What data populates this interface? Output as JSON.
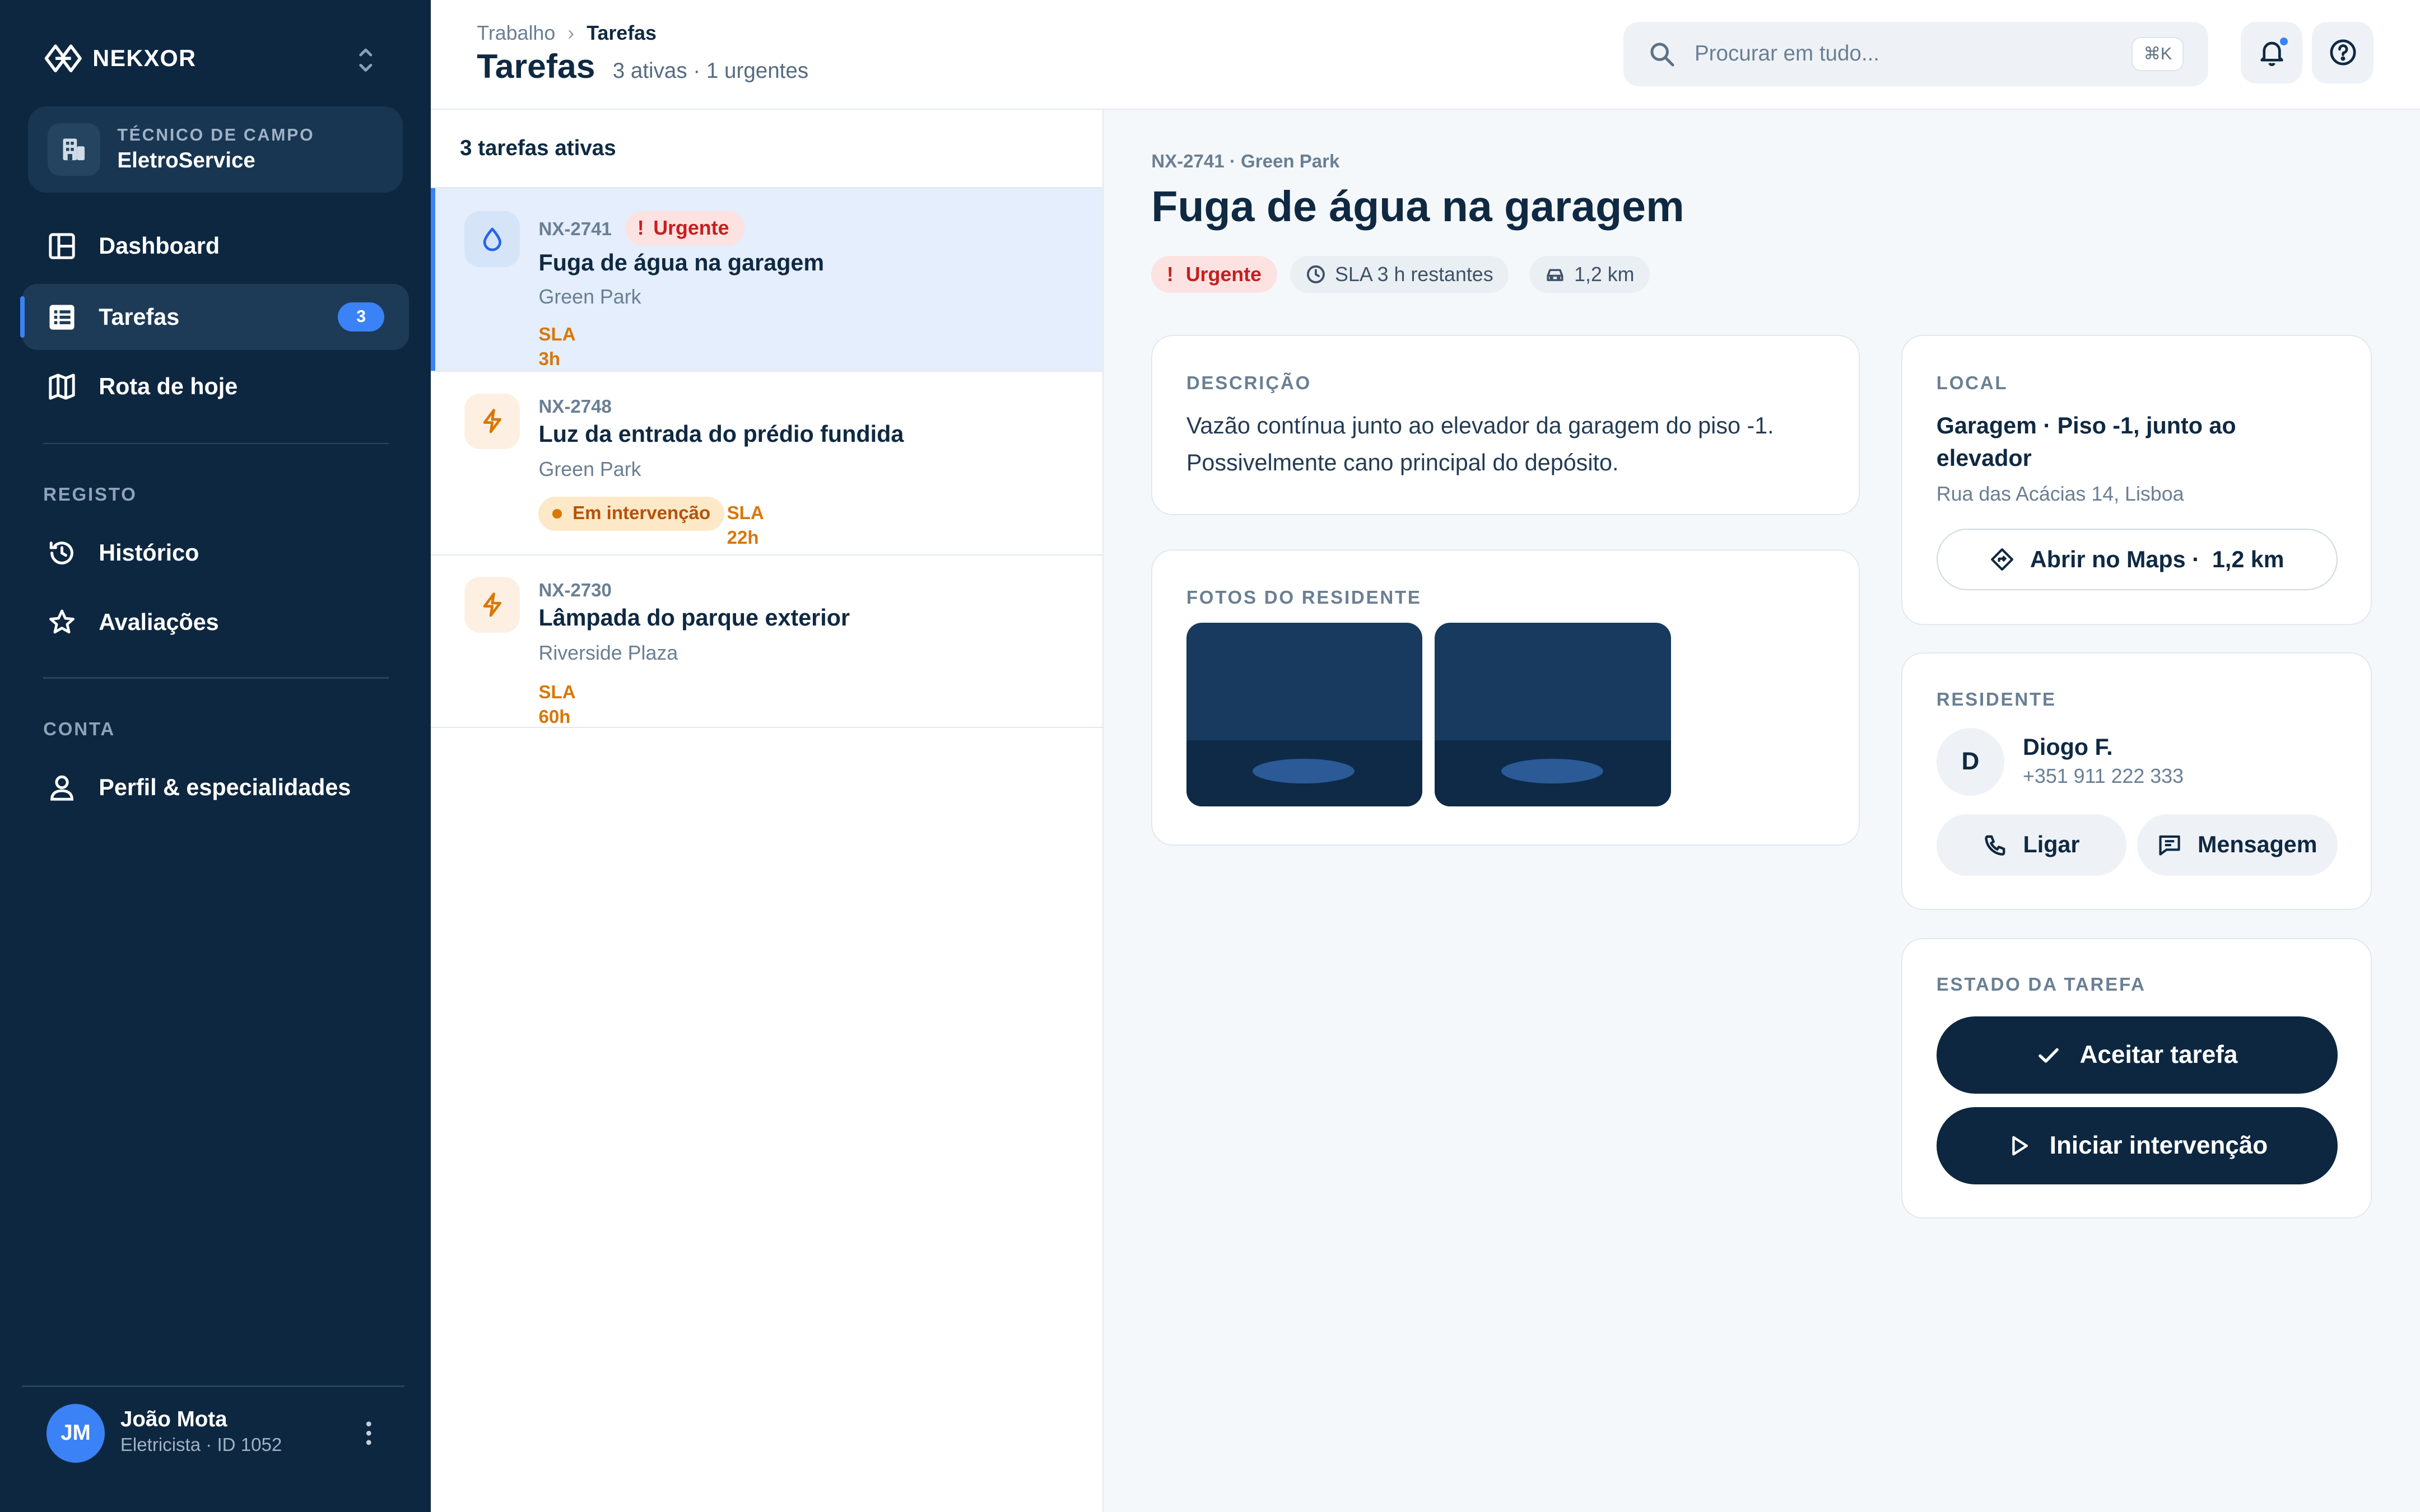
{
  "brand": {
    "name": "NEKXOR"
  },
  "org": {
    "role": "TÉCNICO DE CAMPO",
    "name": "EletroService"
  },
  "nav": {
    "items": [
      {
        "label": "Dashboard"
      },
      {
        "label": "Tarefas",
        "badge": "3"
      },
      {
        "label": "Rota de hoje"
      }
    ],
    "registo_label": "REGISTO",
    "registo_items": [
      {
        "label": "Histórico"
      },
      {
        "label": "Avaliações"
      }
    ],
    "conta_label": "CONTA",
    "conta_items": [
      {
        "label": "Perfil & especialidades"
      }
    ]
  },
  "user": {
    "initials": "JM",
    "name": "João Mota",
    "subtitle": "Eletricista · ID 1052"
  },
  "header": {
    "breadcrumb": [
      "Trabalho",
      "Tarefas"
    ],
    "title": "Tarefas",
    "subtitle": "3 ativas · 1 urgentes",
    "search_placeholder": "Procurar em tudo...",
    "search_shortcut": "⌘K"
  },
  "list": {
    "heading": "3 tarefas ativas",
    "tasks": [
      {
        "id": "NX-2741",
        "urgent_label": "Urgente",
        "title": "Fuga de água na garagem",
        "location": "Green Park",
        "sla_label": "SLA",
        "sla_value": "3h",
        "icon": "droplet-icon"
      },
      {
        "id": "NX-2748",
        "title": "Luz da entrada do prédio fundida",
        "location": "Green Park",
        "status": "Em intervenção",
        "sla_label": "SLA",
        "sla_value": "22h",
        "icon": "bolt-icon"
      },
      {
        "id": "NX-2730",
        "title": "Lâmpada do parque exterior",
        "location": "Riverside Plaza",
        "sla_label": "SLA",
        "sla_value": "60h",
        "icon": "bolt-icon"
      }
    ]
  },
  "detail": {
    "meta": "NX-2741 · Green Park",
    "title": "Fuga de água na garagem",
    "chips": {
      "urgent": "Urgente",
      "sla": "SLA 3 h restantes",
      "distance": "1,2 km"
    },
    "description": {
      "label": "DESCRIÇÃO",
      "text": "Vazão contínua junto ao elevador da garagem do piso -1. Possivelmente cano principal do depósito."
    },
    "photos": {
      "label": "FOTOS DO RESIDENTE"
    },
    "location": {
      "label": "LOCAL",
      "title": "Garagem · Piso -1, junto ao elevador",
      "address": "Rua das Acácias 14, Lisboa",
      "maps_button": "Abrir no Maps ·",
      "maps_distance": "1,2 km"
    },
    "resident": {
      "label": "RESIDENTE",
      "initial": "D",
      "name": "Diogo F.",
      "phone": "+351 911 222 333",
      "call_button": "Ligar",
      "message_button": "Mensagem"
    },
    "status": {
      "label": "ESTADO DA TAREFA",
      "accept_button": "Aceitar tarefa",
      "start_button": "Iniciar intervenção"
    }
  },
  "colors": {
    "sidebar_bg": "#0d2740",
    "accent": "#3b82f6",
    "urgent": "#c81e1e",
    "sla": "#d97706"
  }
}
